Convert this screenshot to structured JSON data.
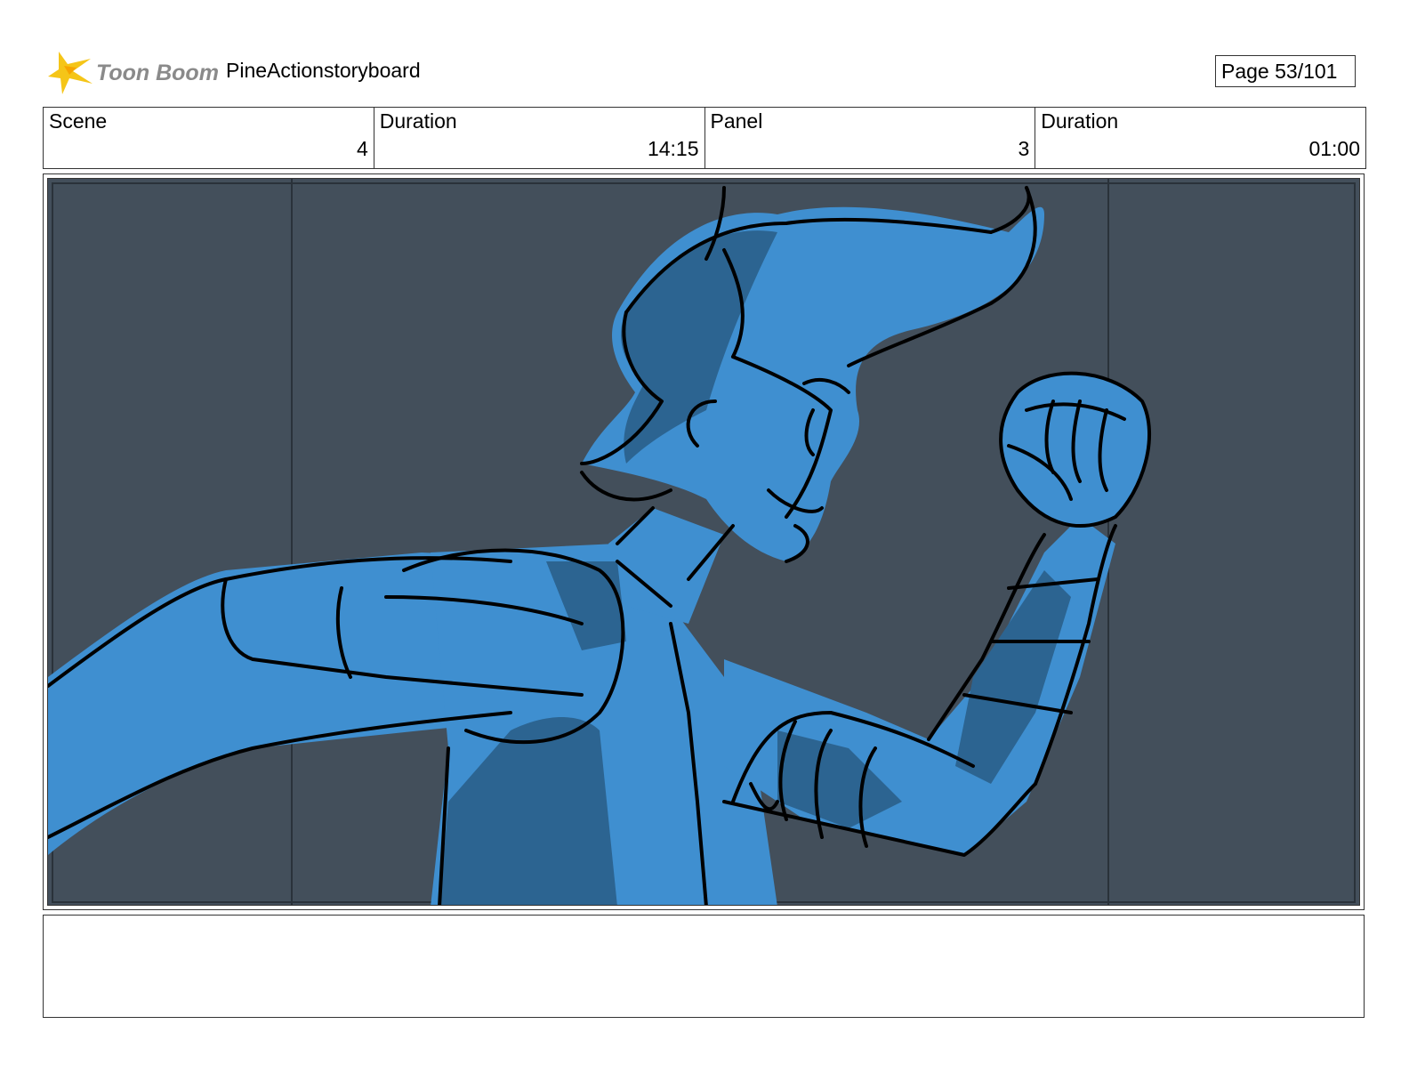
{
  "header": {
    "logo_text": "Toon Boom",
    "project_title": "PineActionstoryboard",
    "page_label": "Page  53/101"
  },
  "info": [
    {
      "label": "Scene",
      "value": "4"
    },
    {
      "label": "Duration",
      "value": "14:15"
    },
    {
      "label": "Panel",
      "value": "3"
    },
    {
      "label": "Duration",
      "value": "01:00"
    }
  ],
  "panel": {
    "icon": "storyboard-drawing",
    "colors": {
      "background": "#434f5b",
      "fill": "#3f8fd0",
      "shadow": "#2c6491",
      "line": "#000000"
    }
  },
  "colors": {
    "logo_star": "#f5c518",
    "logo_text": "#8a8a8a"
  }
}
